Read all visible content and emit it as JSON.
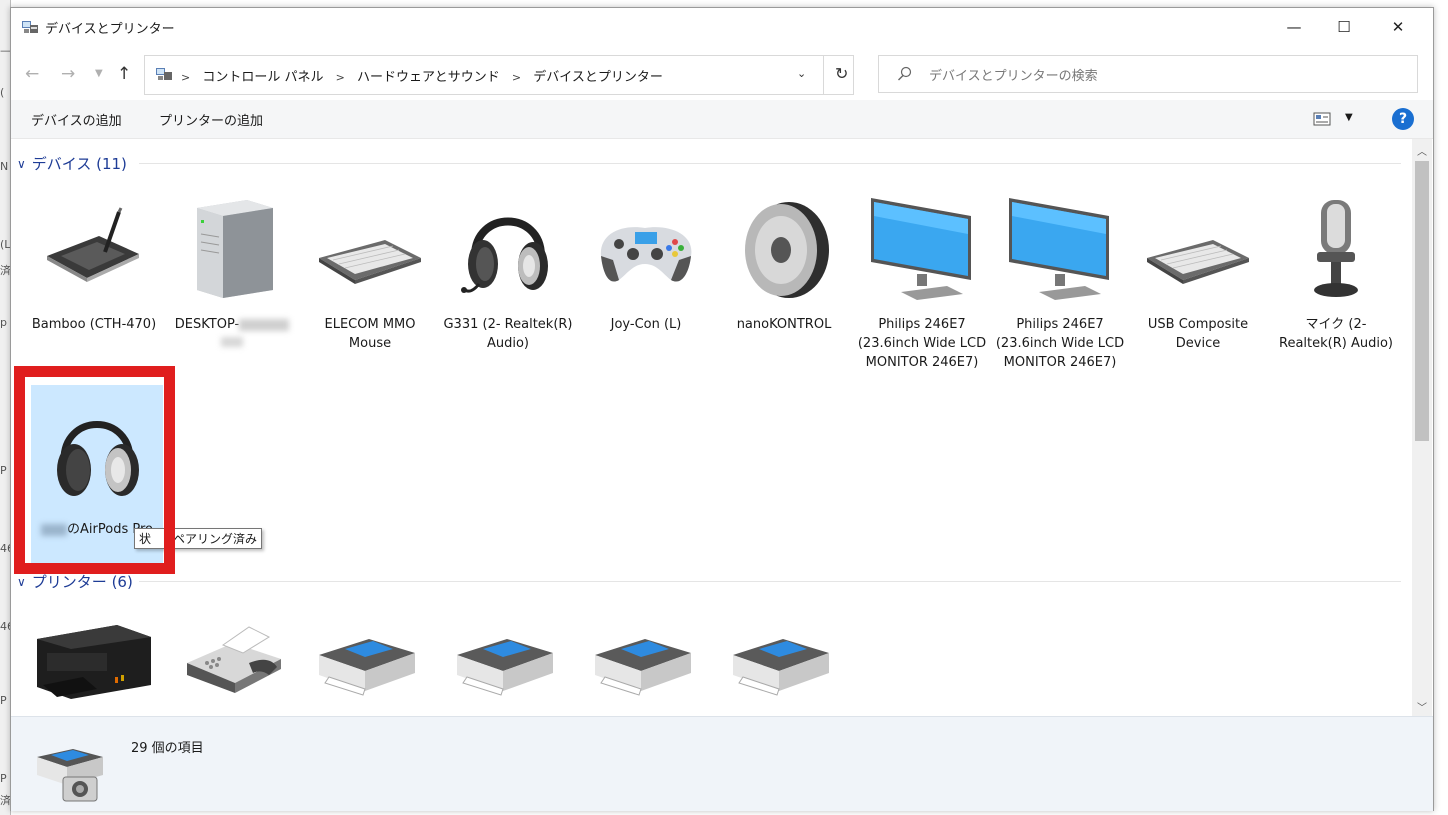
{
  "window": {
    "title": "デバイスとプリンター",
    "controls": {
      "minimize": "—",
      "maximize": "☐",
      "close": "✕"
    }
  },
  "address": {
    "breadcrumbs": [
      "コントロール パネル",
      "ハードウェアとサウンド",
      "デバイスとプリンター"
    ],
    "search_placeholder": "デバイスとプリンターの検索"
  },
  "toolbar": {
    "add_device": "デバイスの追加",
    "add_printer": "プリンターの追加",
    "help": "?"
  },
  "devices_group": {
    "header": "デバイス (11)",
    "items": [
      {
        "label": "Bamboo (CTH-470)",
        "icon": "pen-tablet-icon"
      },
      {
        "label": "DESKTOP-",
        "icon": "desktop-tower-icon"
      },
      {
        "label": "ELECOM MMO Mouse",
        "icon": "keyboard-icon"
      },
      {
        "label": "G331 (2- Realtek(R) Audio)",
        "icon": "headset-icon"
      },
      {
        "label": "Joy-Con (L)",
        "icon": "gamepad-icon"
      },
      {
        "label": "nanoKONTROL",
        "icon": "speaker-icon"
      },
      {
        "label": "Philips 246E7 (23.6inch Wide LCD MONITOR 246E7)",
        "icon": "monitor-icon"
      },
      {
        "label": "Philips 246E7 (23.6inch Wide LCD MONITOR 246E7)",
        "icon": "monitor-icon"
      },
      {
        "label": "USB Composite Device",
        "icon": "keyboard-icon"
      },
      {
        "label": "マイク (2- Realtek(R) Audio)",
        "icon": "microphone-icon"
      },
      {
        "label": "のAirPods Pro",
        "icon": "headphones-icon"
      }
    ]
  },
  "tooltip": {
    "prefix": "状",
    "text": "ペアリング済み"
  },
  "printers_group": {
    "header": "プリンター (6)"
  },
  "status": {
    "count": "29 個の項目"
  },
  "colors": {
    "accent": "#1e3c96",
    "highlight": "#e01e1e",
    "selection": "#cce8ff"
  }
}
